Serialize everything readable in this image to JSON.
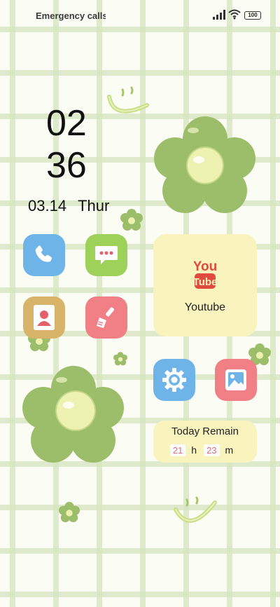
{
  "status_bar": {
    "carrier_text": "Emergency calls o",
    "battery": "100"
  },
  "clock": {
    "hours": "02",
    "minutes": "36",
    "date": "03.14",
    "weekday": "Thur"
  },
  "widgets": {
    "youtube": {
      "logo_line1": "You",
      "logo_line2": "Tube",
      "label": "Youtube"
    },
    "timer": {
      "title": "Today Remain",
      "hours": "21",
      "hours_unit": "h",
      "minutes": "23",
      "minutes_unit": "m"
    }
  },
  "apps": [
    "phone-icon",
    "message-icon",
    "contacts-icon",
    "cleaner-icon",
    "settings-icon",
    "gallery-icon"
  ],
  "colors": {
    "background": "#fbfcf4",
    "grid": "#d6e4be",
    "flower": "#9cbe6a",
    "flower_center": "#eef2b0",
    "widget": "#f9f4bd",
    "blue": "#6fb4e8",
    "green": "#9ed15a",
    "pink": "#f07f86",
    "tan": "#d8b46a"
  }
}
